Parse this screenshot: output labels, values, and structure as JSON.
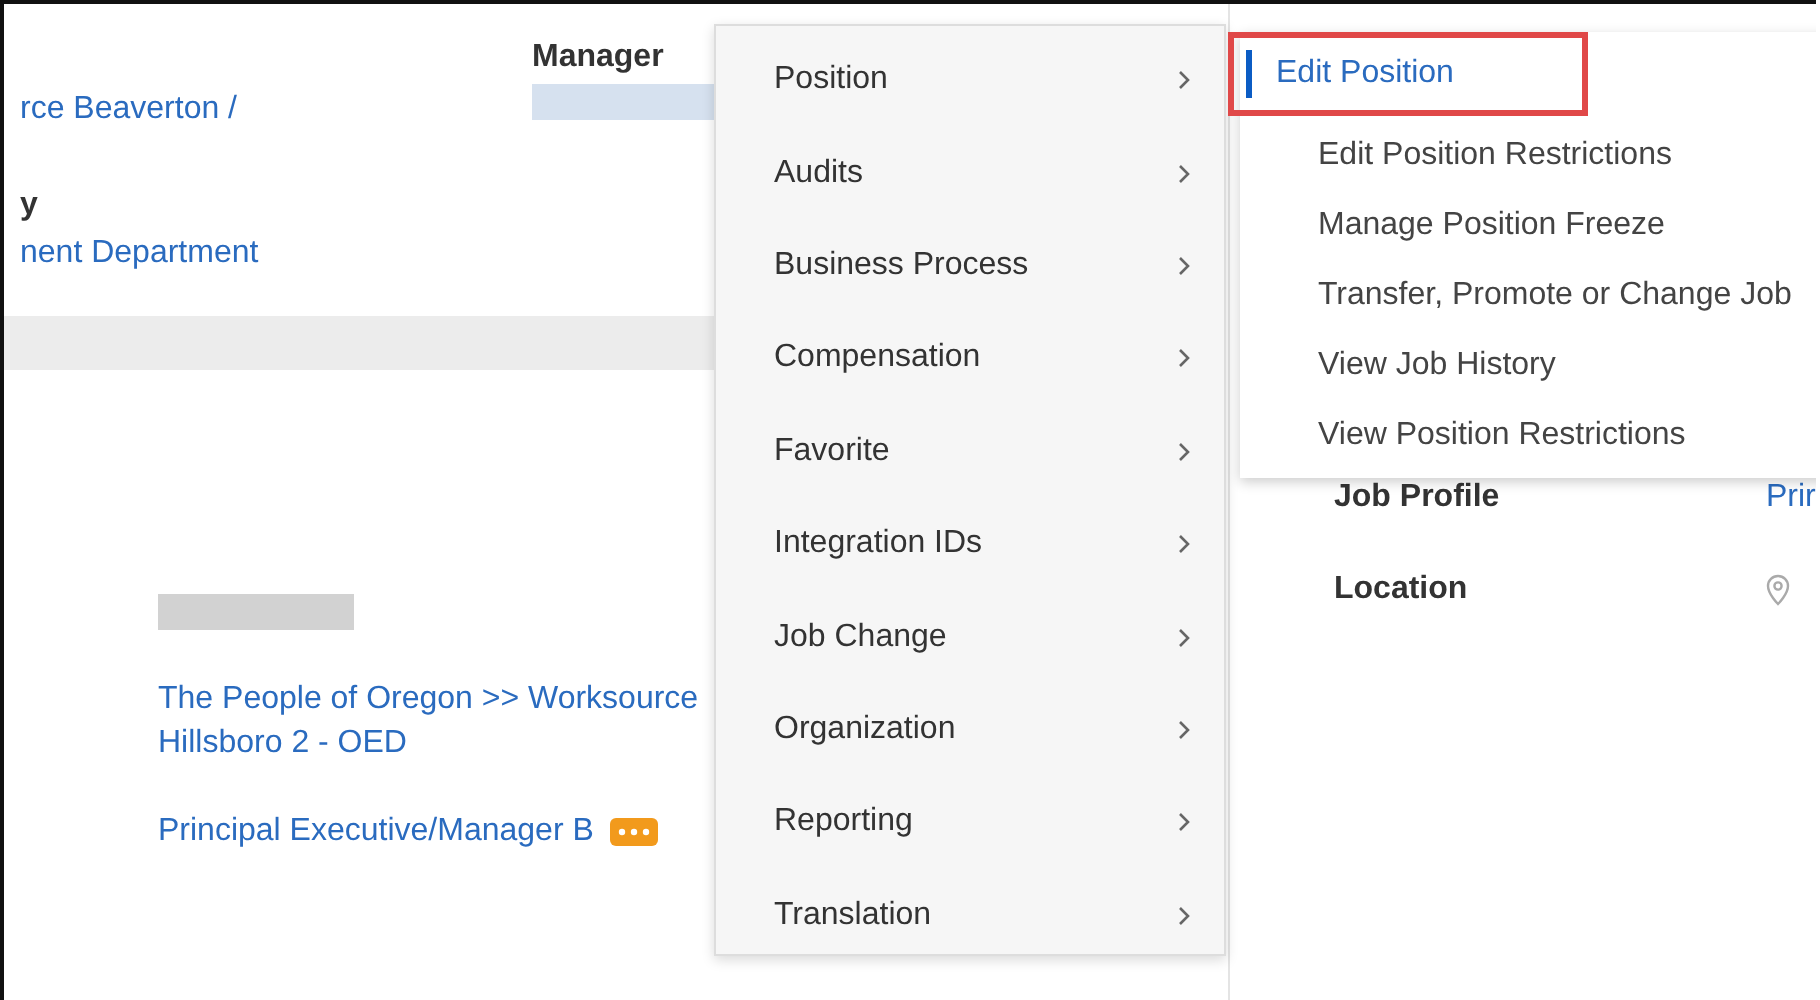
{
  "page": {
    "manager_label": "Manager",
    "fragments": [
      {
        "kind": "link",
        "text": "rce Beaverton /"
      },
      {
        "kind": "label",
        "text": "y"
      },
      {
        "kind": "link",
        "text": "nent Department"
      }
    ],
    "links": [
      {
        "text": "The People of Oregon >> Worksource Hillsboro 2 - OED",
        "related_actions": false
      },
      {
        "text": "Principal Executive/Manager B",
        "related_actions": true
      }
    ],
    "details": [
      {
        "label": "Job Profile",
        "value": "Prir",
        "kind": "link"
      },
      {
        "label": "Location",
        "kind": "location"
      }
    ]
  },
  "menu": {
    "items": [
      {
        "label": "Position",
        "submenu": true
      },
      {
        "label": "Audits",
        "submenu": true
      },
      {
        "label": "Business Process",
        "submenu": true
      },
      {
        "label": "Compensation",
        "submenu": true
      },
      {
        "label": "Favorite",
        "submenu": true
      },
      {
        "label": "Integration IDs",
        "submenu": true
      },
      {
        "label": "Job Change",
        "submenu": true
      },
      {
        "label": "Organization",
        "submenu": true
      },
      {
        "label": "Reporting",
        "submenu": true
      },
      {
        "label": "Translation",
        "submenu": true
      }
    ]
  },
  "submenu": {
    "items": [
      {
        "label": "Edit Position",
        "selected": true,
        "highlighted": true
      },
      {
        "label": "Edit Position Restrictions",
        "selected": false,
        "highlighted": false
      },
      {
        "label": "Manage Position Freeze",
        "selected": false,
        "highlighted": false
      },
      {
        "label": "Transfer, Promote or Change Job",
        "selected": false,
        "highlighted": false
      },
      {
        "label": "View Job History",
        "selected": false,
        "highlighted": false
      },
      {
        "label": "View Position Restrictions",
        "selected": false,
        "highlighted": false
      }
    ]
  }
}
